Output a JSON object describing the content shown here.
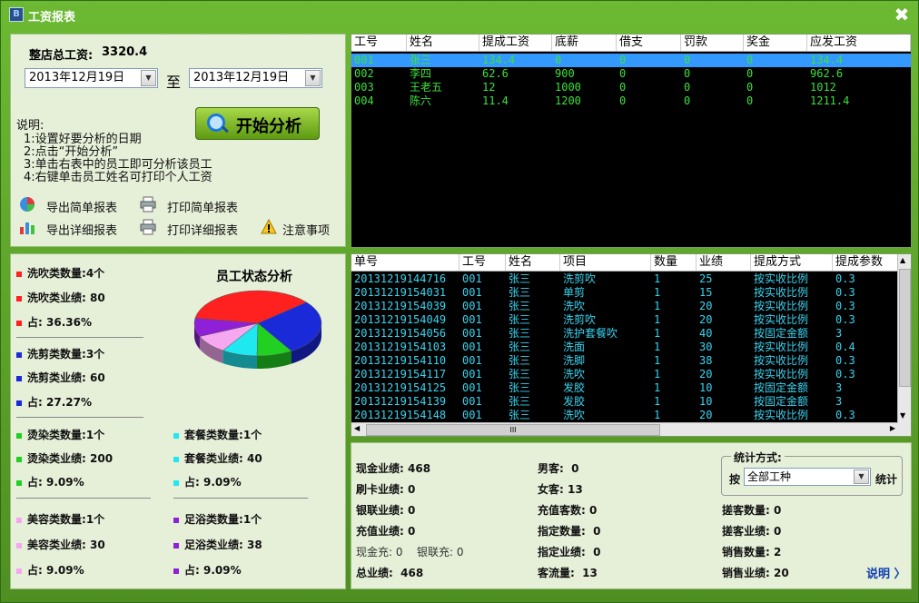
{
  "window": {
    "title": "工资报表",
    "close": "✖"
  },
  "left_top": {
    "total_salary_label": "整店总工资:",
    "total_salary_value": "3320.4",
    "date_from": "2013年12月19日",
    "to_label": "至",
    "date_to": "2013年12月19日",
    "start_button": "开始分析",
    "notes": [
      "说明:",
      "1:设置好要分析的日期",
      "2:点击“开始分析”",
      "3:单击右表中的员工即可分析该员工",
      "4:右键单击员工姓名可打印个人工资"
    ],
    "actions": {
      "export_simple": "导出简单报表",
      "print_simple": "打印简单报表",
      "export_detail": "导出详细报表",
      "print_detail": "打印详细报表",
      "notice": "注意事项"
    }
  },
  "staff_table": {
    "headers": [
      "工号",
      "姓名",
      "提成工资",
      "底薪",
      "借支",
      "罚款",
      "奖金",
      "应发工资"
    ],
    "rows": [
      [
        "001",
        "张三",
        "134.4",
        "0",
        "0",
        "0",
        "0",
        "134.4"
      ],
      [
        "002",
        "李四",
        "62.6",
        "900",
        "0",
        "0",
        "0",
        "962.6"
      ],
      [
        "003",
        "王老五",
        "12",
        "1000",
        "0",
        "0",
        "0",
        "1012"
      ],
      [
        "004",
        "陈六",
        "11.4",
        "1200",
        "0",
        "0",
        "0",
        "1211.4"
      ]
    ],
    "selected_row": 0
  },
  "detail_table": {
    "headers": [
      "单号",
      "工号",
      "姓名",
      "项目",
      "数量",
      "业绩",
      "提成方式",
      "提成参数"
    ],
    "rows": [
      [
        "20131219144716",
        "001",
        "张三",
        "洗剪吹",
        "1",
        "25",
        "按实收比例",
        "0.3"
      ],
      [
        "20131219154031",
        "001",
        "张三",
        "单剪",
        "1",
        "15",
        "按实收比例",
        "0.3"
      ],
      [
        "20131219154039",
        "001",
        "张三",
        "洗吹",
        "1",
        "20",
        "按实收比例",
        "0.3"
      ],
      [
        "20131219154049",
        "001",
        "张三",
        "洗剪吹",
        "1",
        "20",
        "按实收比例",
        "0.3"
      ],
      [
        "20131219154056",
        "001",
        "张三",
        "洗护套餐吹",
        "1",
        "40",
        "按固定金额",
        "3"
      ],
      [
        "20131219154103",
        "001",
        "张三",
        "洗面",
        "1",
        "30",
        "按实收比例",
        "0.4"
      ],
      [
        "20131219154110",
        "001",
        "张三",
        "洗脚",
        "1",
        "38",
        "按实收比例",
        "0.3"
      ],
      [
        "20131219154117",
        "001",
        "张三",
        "洗吹",
        "1",
        "20",
        "按实收比例",
        "0.3"
      ],
      [
        "20131219154125",
        "001",
        "张三",
        "发胶",
        "1",
        "10",
        "按固定金额",
        "3"
      ],
      [
        "20131219154139",
        "001",
        "张三",
        "发胶",
        "1",
        "10",
        "按固定金额",
        "3"
      ],
      [
        "20131219154148",
        "001",
        "张三",
        "洗吹",
        "1",
        "20",
        "按实收比例",
        "0.3"
      ]
    ],
    "scroll_grip": "III"
  },
  "analysis": {
    "title": "员工状态分析",
    "groups": [
      {
        "key": "xichui",
        "color": "#ff2020",
        "count_label": "洗吹类数量:",
        "count": "4个",
        "perf_label": "洗吹类业绩:",
        "perf": "80",
        "pct_label": "占:",
        "pct": "36.36%",
        "share": 36.36
      },
      {
        "key": "xijian",
        "color": "#1a2ad8",
        "count_label": "洗剪类数量:",
        "count": "3个",
        "perf_label": "洗剪类业绩:",
        "perf": "60",
        "pct_label": "占:",
        "pct": "27.27%",
        "share": 27.27
      },
      {
        "key": "tangran",
        "color": "#22d022",
        "count_label": "烫染类数量:",
        "count": "1个",
        "perf_label": "烫染类业绩:",
        "perf": "200",
        "pct_label": "占:",
        "pct": "9.09%",
        "share": 9.09
      },
      {
        "key": "taocan",
        "color": "#20e8f0",
        "count_label": "套餐类数量:",
        "count": "1个",
        "perf_label": "套餐类业绩:",
        "perf": "40",
        "pct_label": "占:",
        "pct": "9.09%",
        "share": 9.09
      },
      {
        "key": "meirong",
        "color": "#f5a8f0",
        "count_label": "美容类数量:",
        "count": "1个",
        "perf_label": "美容类业绩:",
        "perf": "30",
        "pct_label": "占:",
        "pct": "9.09%",
        "share": 9.09
      },
      {
        "key": "zuyu",
        "color": "#9020d8",
        "count_label": "足浴类数量:",
        "count": "1个",
        "perf_label": "足浴类业绩:",
        "perf": "38",
        "pct_label": "占:",
        "pct": "9.09%",
        "share": 9.09
      }
    ]
  },
  "summary": {
    "cash_perf": {
      "label": "现金业绩:",
      "value": "468"
    },
    "card_perf": {
      "label": "刷卡业绩:",
      "value": "0"
    },
    "union_perf": {
      "label": "银联业绩:",
      "value": "0"
    },
    "recharge_perf": {
      "label": "充值业绩:",
      "value": "0"
    },
    "cash_recharge": "现金充: 0",
    "union_recharge": "银联充: 0",
    "total_perf": {
      "label": "总业绩:",
      "value": "468"
    },
    "male": {
      "label": "男客:",
      "value": "0"
    },
    "female": {
      "label": "女客:",
      "value": "13"
    },
    "recharge_count": {
      "label": "充值客数:",
      "value": "0"
    },
    "assigned_count": {
      "label": "指定数量:",
      "value": "0"
    },
    "assigned_perf": {
      "label": "指定业绩:",
      "value": "0"
    },
    "traffic": {
      "label": "客流量:",
      "value": "13"
    },
    "solicit_count": {
      "label": "搓客数量:",
      "value": "0"
    },
    "solicit_perf": {
      "label": "搓客业绩:",
      "value": "0"
    },
    "sales_count": {
      "label": "销售数量:",
      "value": "2"
    },
    "sales_perf": {
      "label": "销售业绩:",
      "value": "20"
    },
    "stat_mode": {
      "title": "统计方式:",
      "by": "按",
      "option": "全部工种",
      "suffix": "统计"
    },
    "help_link": "说明 〉"
  },
  "colors": {
    "accent_green": "#5fa32a",
    "panel_bg": "#e6efd8",
    "grid_green": "#3de03d",
    "grid_cyan": "#3ad4f0",
    "selection": "#3399ff"
  }
}
